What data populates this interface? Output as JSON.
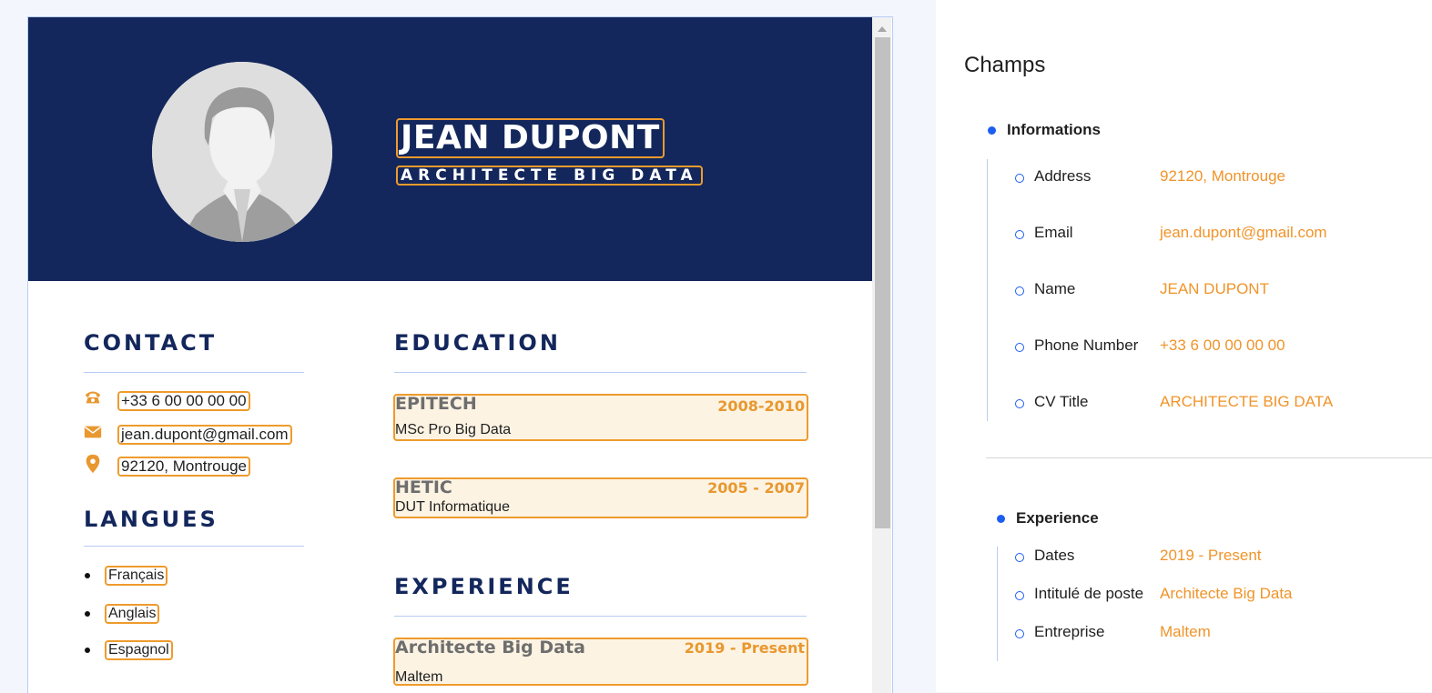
{
  "cv": {
    "name": "JEAN DUPONT",
    "title": "ARCHITECTE BIG DATA",
    "contact": {
      "heading": "CONTACT",
      "phone": "+33 6 00 00 00 00",
      "email": "jean.dupont@gmail.com",
      "address": "92120, Montrouge"
    },
    "languages": {
      "heading": "LANGUES",
      "items": [
        "Français",
        "Anglais",
        "Espagnol"
      ]
    },
    "education": {
      "heading": "EDUCATION",
      "items": [
        {
          "school": "EPITECH",
          "dates": "2008-2010",
          "degree": "MSc Pro Big Data"
        },
        {
          "school": "HETIC",
          "dates": "2005 - 2007",
          "degree": "DUT Informatique"
        }
      ]
    },
    "experience": {
      "heading": "EXPERIENCE",
      "items": [
        {
          "role": "Architecte Big Data",
          "dates": "2019 - Present",
          "company": "Maltem"
        }
      ]
    }
  },
  "fields_panel": {
    "title": "Champs",
    "groups": [
      {
        "label": "Informations",
        "fields": [
          {
            "key": "Address",
            "value": "92120, Montrouge"
          },
          {
            "key": "Email",
            "value": "jean.dupont@gmail.com"
          },
          {
            "key": "Name",
            "value": "JEAN DUPONT"
          },
          {
            "key": "Phone Number",
            "value": "+33 6 00 00 00 00"
          },
          {
            "key": "CV Title",
            "value": "ARCHITECTE BIG DATA"
          }
        ]
      },
      {
        "label": "Experience",
        "fields": [
          {
            "key": "Dates",
            "value": "2019 - Present"
          },
          {
            "key": "Intitulé de poste",
            "value": "Architecte Big Data"
          },
          {
            "key": "Entreprise",
            "value": "Maltem"
          }
        ]
      }
    ]
  },
  "icons": {
    "avatar": "avatar-placeholder",
    "phone": "phone-icon",
    "email": "envelope-icon",
    "address": "location-pin-icon"
  },
  "colors": {
    "header_bg": "#13275c",
    "highlight": "#ee9b2d",
    "accent": "#1d5df0",
    "field_value": "#f0942a"
  }
}
